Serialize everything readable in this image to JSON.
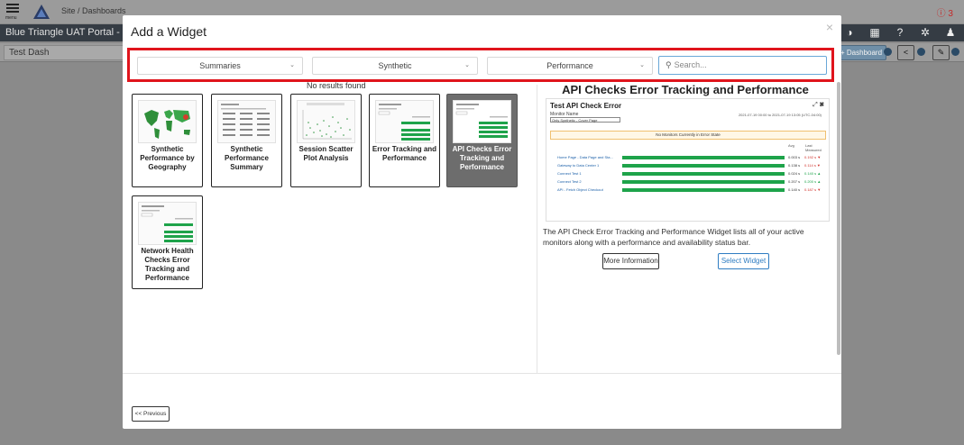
{
  "app": {
    "menu_label": "menu",
    "breadcrumb": "Site / Dashboards",
    "alert_count": "ⓘ 3",
    "portal_title": "Blue Triangle UAT Portal - Please",
    "dashboard_name": "Test Dash",
    "dashboard_button": "+ Dashboard",
    "icons": [
      "contrast-icon",
      "calendar-icon",
      "help-icon",
      "settings-icon",
      "user-icon"
    ]
  },
  "modal": {
    "title": "Add a Widget",
    "close_label": "×",
    "filters": {
      "category": "Summaries",
      "source": "Synthetic",
      "metric": "Performance",
      "search_placeholder": "Search..."
    },
    "no_results": "No results found",
    "widgets": [
      {
        "name": "Synthetic Performance by Geography"
      },
      {
        "name": "Synthetic Performance Summary"
      },
      {
        "name": "Session Scatter Plot Analysis"
      },
      {
        "name": "Error Tracking and Performance"
      },
      {
        "name": "API Checks Error Tracking and Performance",
        "selected": true
      },
      {
        "name": "Network Health Checks Error Tracking and Performance"
      }
    ],
    "preview": {
      "heading": "API Checks Error Tracking and Performance",
      "widget_title": "Test API Check Error",
      "tools": "⤢ ✖",
      "monitor_label": "Monitor Name",
      "monitor_select": "Only Synthetic - Cover Page",
      "date_range": "2021-07-19 00:00 to 2021-07-19 13:05 (UTC-04:00)",
      "status_message": "No Monitors Currently in Error State",
      "col_avg": "Avg",
      "col_last": "Last Measured",
      "rows": [
        {
          "name": "Home Page - Data Page and Sta...",
          "avg": "0.003 s",
          "last": "0.192 s ▼"
        },
        {
          "name": "Gateway to Data Center 1",
          "avg": "0.138 s",
          "last": "0.114 s ▼"
        },
        {
          "name": "Connect Test 1",
          "avg": "0.024 s",
          "last": "0.140 s ▲"
        },
        {
          "name": "Connect Test 2",
          "avg": "0.207 s",
          "last": "0.200 s ▲"
        },
        {
          "name": "API - Fetch Object Checkout",
          "avg": "0.140 s",
          "last": "0.187 s ▼"
        }
      ],
      "description": "The API Check Error Tracking and Performance Widget lists all of your active monitors along with a performance and availability status bar.",
      "more_info_label": "More Information",
      "select_label": "Select Widget"
    },
    "previous_label": "<< Previous"
  },
  "colors": {
    "highlight": "#e0141c",
    "accent": "#2f7dc2",
    "bar_green": "#1ea34a",
    "header_dark": "#353c44"
  }
}
